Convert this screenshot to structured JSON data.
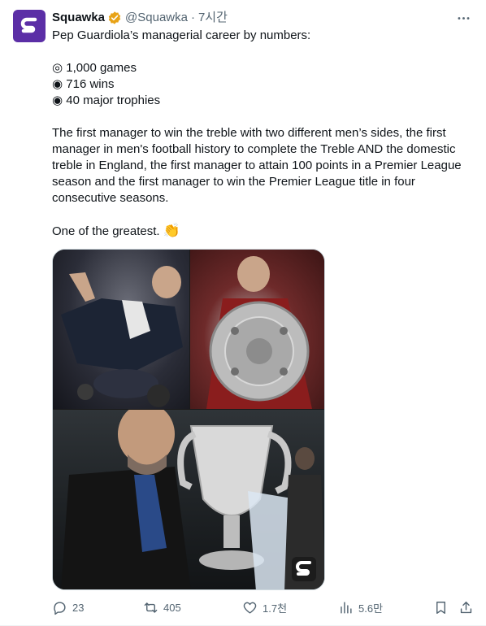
{
  "author": {
    "name": "Squawka",
    "handle": "@Squawka",
    "separator": "·",
    "time": "7시간"
  },
  "tweet": {
    "lines": [
      "Pep Guardiola’s managerial career by numbers:",
      "",
      "◎ 1,000 games",
      "◉ 716 wins",
      "◉ 40 major trophies",
      "",
      "The first manager to win the treble with two different men’s sides, the first manager in men's football history to complete the Treble AND the domestic treble in England, the first manager to attain 100 points in a Premier League season and the first manager to win the Premier League title in four consecutive seasons.",
      "",
      "One of the greatest."
    ],
    "emoji": "👏"
  },
  "actions": {
    "replies": "23",
    "retweets": "405",
    "likes": "1.7천",
    "views": "5.6만"
  },
  "colors": {
    "brand": "#5b2ea6",
    "verified": "#e8a317",
    "secondary_text": "#536471",
    "border": "#cfd9de"
  },
  "icons": {
    "more": "more-horizontal-icon",
    "reply": "reply-icon",
    "retweet": "retweet-icon",
    "like": "heart-icon",
    "views": "views-chart-icon",
    "bookmark": "bookmark-icon",
    "share": "share-icon",
    "verified": "verified-badge-icon"
  }
}
